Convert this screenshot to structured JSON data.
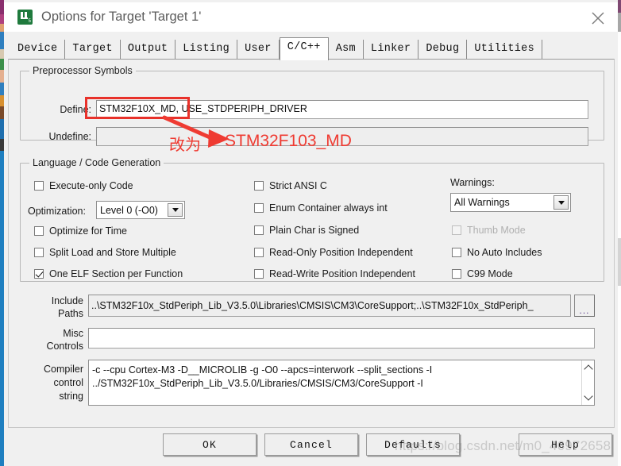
{
  "window": {
    "title": "Options for Target 'Target 1'",
    "app_icon": "keil-uvision-icon",
    "close_icon": "close-icon"
  },
  "tabs": [
    {
      "label": "Device",
      "active": false
    },
    {
      "label": "Target",
      "active": false
    },
    {
      "label": "Output",
      "active": false
    },
    {
      "label": "Listing",
      "active": false
    },
    {
      "label": "User",
      "active": false
    },
    {
      "label": "C/C++",
      "active": true
    },
    {
      "label": "Asm",
      "active": false
    },
    {
      "label": "Linker",
      "active": false
    },
    {
      "label": "Debug",
      "active": false
    },
    {
      "label": "Utilities",
      "active": false
    }
  ],
  "preprocessor": {
    "group_title": "Preprocessor Symbols",
    "define_label": "Define:",
    "define_value": "STM32F10X_MD, USE_STDPERIPH_DRIVER",
    "undefine_label": "Undefine:",
    "undefine_value": ""
  },
  "language": {
    "group_title": "Language / Code Generation",
    "optimization_label": "Optimization:",
    "optimization_value": "Level 0 (-O0)",
    "warnings_label": "Warnings:",
    "warnings_value": "All Warnings",
    "col1": [
      {
        "label": "Execute-only Code",
        "checked": false,
        "disabled": false
      },
      {
        "label": "Optimize for Time",
        "checked": false,
        "disabled": false
      },
      {
        "label": "Split Load and Store Multiple",
        "checked": false,
        "disabled": false
      },
      {
        "label": "One ELF Section per Function",
        "checked": true,
        "disabled": false
      }
    ],
    "col2": [
      {
        "label": "Strict ANSI C",
        "checked": false,
        "disabled": false
      },
      {
        "label": "Enum Container always int",
        "checked": false,
        "disabled": false
      },
      {
        "label": "Plain Char is Signed",
        "checked": false,
        "disabled": false
      },
      {
        "label": "Read-Only Position Independent",
        "checked": false,
        "disabled": false
      },
      {
        "label": "Read-Write Position Independent",
        "checked": false,
        "disabled": false
      }
    ],
    "col3": [
      {
        "label": "Thumb Mode",
        "checked": false,
        "disabled": true
      },
      {
        "label": "No Auto Includes",
        "checked": false,
        "disabled": false
      },
      {
        "label": "C99 Mode",
        "checked": false,
        "disabled": false
      }
    ]
  },
  "paths": {
    "include_label_line1": "Include",
    "include_label_line2": "Paths",
    "include_value": "..\\STM32F10x_StdPeriph_Lib_V3.5.0\\Libraries\\CMSIS\\CM3\\CoreSupport;..\\STM32F10x_StdPeriph_",
    "browse_label": "...",
    "misc_label_line1": "Misc",
    "misc_label_line2": "Controls",
    "misc_value": ""
  },
  "compiler": {
    "label_line1": "Compiler",
    "label_line2": "control",
    "label_line3": "string",
    "line1": "-c --cpu Cortex-M3 -D__MICROLIB -g -O0 --apcs=interwork --split_sections -I",
    "line2": "../STM32F10x_StdPeriph_Lib_V3.5.0/Libraries/CMSIS/CM3/CoreSupport -I"
  },
  "buttons": {
    "ok": "OK",
    "cancel": "Cancel",
    "defaults": "Defaults",
    "help": "Help"
  },
  "annotation": {
    "chinese_note": "改为",
    "target_text": "STM32F103_MD",
    "color": "#ef3b32"
  },
  "watermark": {
    "text": "https://blog.csdn.net/m0_46972658"
  }
}
